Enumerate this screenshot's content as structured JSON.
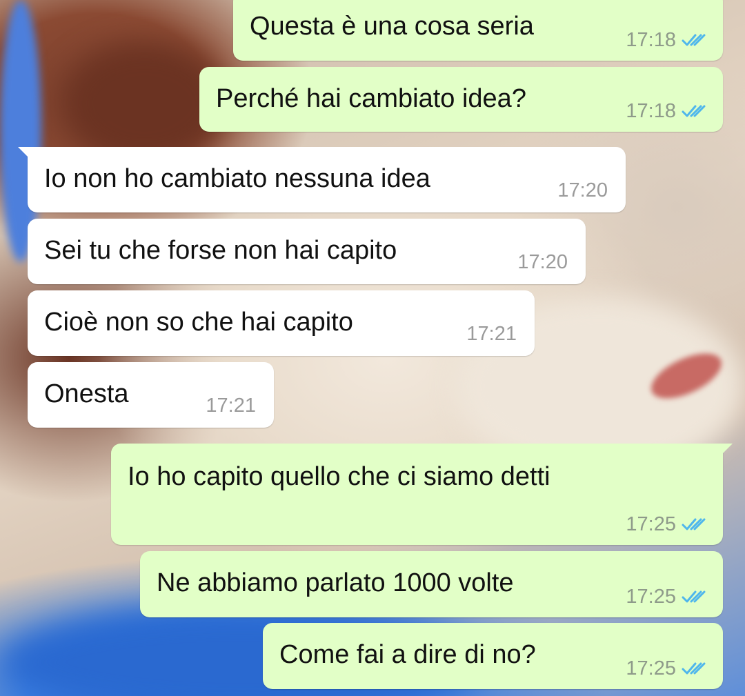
{
  "conversation": {
    "messages": [
      {
        "direction": "outgoing",
        "text": "Questa è una cosa seria",
        "time": "17:18",
        "status": "read"
      },
      {
        "direction": "outgoing",
        "text": "Perché hai cambiato idea?",
        "time": "17:18",
        "status": "read"
      },
      {
        "direction": "incoming",
        "text": "Io non ho cambiato nessuna idea",
        "time": "17:20"
      },
      {
        "direction": "incoming",
        "text": "Sei tu che forse non hai capito",
        "time": "17:20"
      },
      {
        "direction": "incoming",
        "text": "Cioè non so che hai capito",
        "time": "17:21"
      },
      {
        "direction": "incoming",
        "text": "Onesta",
        "time": "17:21"
      },
      {
        "direction": "outgoing",
        "text": "Io ho capito quello che ci siamo detti",
        "time": "17:25",
        "status": "read"
      },
      {
        "direction": "outgoing",
        "text": "Ne abbiamo parlato 1000 volte",
        "time": "17:25",
        "status": "read"
      },
      {
        "direction": "outgoing",
        "text": "Come fai a dire di no?",
        "time": "17:25",
        "status": "read"
      }
    ]
  },
  "colors": {
    "outgoing_bubble": "#e2ffc7",
    "incoming_bubble": "#ffffff",
    "read_ticks": "#4fb6ec",
    "timestamp": "#8e9a8a"
  },
  "icons": {
    "read_receipt": "double-check-icon"
  }
}
